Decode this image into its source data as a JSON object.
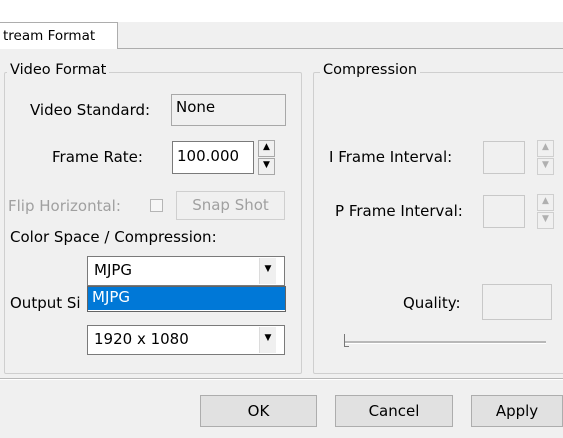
{
  "tab": {
    "label": "tream Format"
  },
  "video_format": {
    "group_label": "Video Format",
    "video_standard_label": "Video Standard:",
    "video_standard_value": "None",
    "frame_rate_label": "Frame Rate:",
    "frame_rate_value": "100.000",
    "flip_horizontal_label": "Flip Horizontal:",
    "snap_shot_label": "Snap Shot",
    "color_space_label": "Color Space / Compression:",
    "color_space_value": "MJPG",
    "dropdown_options": [
      "MJPG"
    ],
    "output_size_label": "Output Si",
    "output_size_value": "1920 x 1080"
  },
  "compression": {
    "group_label": "Compression",
    "i_frame_label": "I Frame Interval:",
    "i_frame_value": "",
    "p_frame_label": "P Frame Interval:",
    "p_frame_value": "",
    "quality_label": "Quality:",
    "quality_value": ""
  },
  "buttons": {
    "ok": "OK",
    "cancel": "Cancel",
    "apply": "Apply"
  },
  "icons": {
    "spin_up": "▲",
    "spin_down": "▼",
    "combo_arrow": "▼",
    "slider_thumb": "slider-thumb"
  },
  "colors": {
    "selection": "#0078d7",
    "window_bg": "#f0f0f0"
  }
}
